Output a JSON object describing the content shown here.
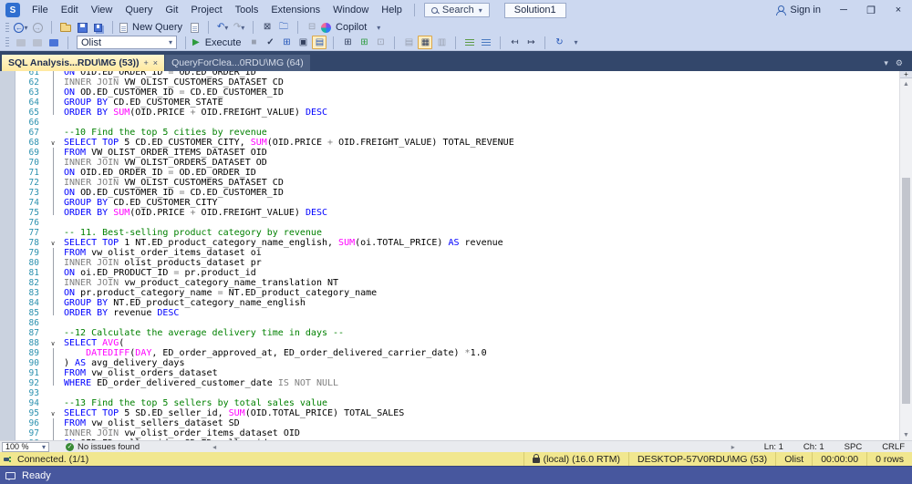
{
  "titlebar": {
    "menus": [
      "File",
      "Edit",
      "View",
      "Query",
      "Git",
      "Project",
      "Tools",
      "Extensions",
      "Window",
      "Help"
    ],
    "search_label": "Search",
    "solution_label": "Solution1",
    "sign_in_label": "Sign in"
  },
  "toolbar_standard": {
    "new_query_label": "New Query",
    "copilot_label": "Copilot"
  },
  "toolbar_sql": {
    "database_selected": "Olist",
    "execute_label": "Execute"
  },
  "tabs": [
    {
      "label": "SQL Analysis...RDU\\MG (53))",
      "active": true
    },
    {
      "label": "QueryForClea...0RDU\\MG (64)",
      "active": false
    }
  ],
  "editor": {
    "first_line_number": 61,
    "lines": [
      {
        "n": 61,
        "fold": false,
        "tokens": [
          [
            "kw",
            "ON"
          ],
          [
            "id",
            " OID.ED_ORDER_ID "
          ],
          [
            "gr",
            "="
          ],
          [
            "id",
            " OD.ED_ORDER_ID"
          ]
        ]
      },
      {
        "n": 62,
        "fold": false,
        "tokens": [
          [
            "gr",
            "INNER JOIN"
          ],
          [
            "id",
            " VW_OLIST_CUSTOMERS_DATASET CD"
          ]
        ]
      },
      {
        "n": 63,
        "fold": false,
        "tokens": [
          [
            "kw",
            "ON"
          ],
          [
            "id",
            " OD.ED_CUSTOMER_ID "
          ],
          [
            "gr",
            "="
          ],
          [
            "id",
            " CD.ED_CUSTOMER_ID"
          ]
        ]
      },
      {
        "n": 64,
        "fold": false,
        "tokens": [
          [
            "kw",
            "GROUP BY"
          ],
          [
            "id",
            " CD.ED_CUSTOMER_STATE"
          ]
        ]
      },
      {
        "n": 65,
        "fold": false,
        "tokens": [
          [
            "kw",
            "ORDER BY"
          ],
          [
            "id",
            " "
          ],
          [
            "fn",
            "SUM"
          ],
          [
            "id",
            "(OID.PRICE "
          ],
          [
            "gr",
            "+"
          ],
          [
            "id",
            " OID.FREIGHT_VALUE) "
          ],
          [
            "kw",
            "DESC"
          ]
        ]
      },
      {
        "n": 66,
        "fold": false,
        "tokens": []
      },
      {
        "n": 67,
        "fold": false,
        "tokens": [
          [
            "cm",
            "--10 Find the top 5 cities by revenue"
          ]
        ]
      },
      {
        "n": 68,
        "fold": true,
        "tokens": [
          [
            "kw",
            "SELECT TOP"
          ],
          [
            "id",
            " 5 CD.ED_CUSTOMER_CITY, "
          ],
          [
            "fn",
            "SUM"
          ],
          [
            "id",
            "(OID.PRICE "
          ],
          [
            "gr",
            "+"
          ],
          [
            "id",
            " OID.FREIGHT_VALUE) TOTAL_REVENUE"
          ]
        ]
      },
      {
        "n": 69,
        "fold": false,
        "tokens": [
          [
            "kw",
            "FROM"
          ],
          [
            "id",
            " VW_OLIST_ORDER_ITEMS_DATASET OID"
          ]
        ]
      },
      {
        "n": 70,
        "fold": false,
        "tokens": [
          [
            "gr",
            "INNER JOIN"
          ],
          [
            "id",
            " VW_OLIST_ORDERS_DATASET OD"
          ]
        ]
      },
      {
        "n": 71,
        "fold": false,
        "tokens": [
          [
            "kw",
            "ON"
          ],
          [
            "id",
            " OID.ED_ORDER_ID "
          ],
          [
            "gr",
            "="
          ],
          [
            "id",
            " OD.ED_ORDER_ID"
          ]
        ]
      },
      {
        "n": 72,
        "fold": false,
        "tokens": [
          [
            "gr",
            "INNER JOIN"
          ],
          [
            "id",
            " VW_OLIST_CUSTOMERS_DATASET CD"
          ]
        ]
      },
      {
        "n": 73,
        "fold": false,
        "tokens": [
          [
            "kw",
            "ON"
          ],
          [
            "id",
            " OD.ED_CUSTOMER_ID "
          ],
          [
            "gr",
            "="
          ],
          [
            "id",
            " CD.ED_CUSTOMER_ID"
          ]
        ]
      },
      {
        "n": 74,
        "fold": false,
        "tokens": [
          [
            "kw",
            "GROUP BY"
          ],
          [
            "id",
            " CD.ED_CUSTOMER_CITY"
          ]
        ]
      },
      {
        "n": 75,
        "fold": false,
        "tokens": [
          [
            "kw",
            "ORDER BY"
          ],
          [
            "id",
            " "
          ],
          [
            "fn",
            "SUM"
          ],
          [
            "id",
            "(OID.PRICE "
          ],
          [
            "gr",
            "+"
          ],
          [
            "id",
            " OID.FREIGHT_VALUE) "
          ],
          [
            "kw",
            "DESC"
          ]
        ]
      },
      {
        "n": 76,
        "fold": false,
        "tokens": []
      },
      {
        "n": 77,
        "fold": false,
        "tokens": [
          [
            "cm",
            "-- 11. Best-selling product category by revenue"
          ]
        ]
      },
      {
        "n": 78,
        "fold": true,
        "tokens": [
          [
            "kw",
            "SELECT TOP"
          ],
          [
            "id",
            " 1 NT.ED_product_category_name_english, "
          ],
          [
            "fn",
            "SUM"
          ],
          [
            "id",
            "(oi.TOTAL_PRICE) "
          ],
          [
            "kw",
            "AS"
          ],
          [
            "id",
            " revenue"
          ]
        ]
      },
      {
        "n": 79,
        "fold": false,
        "tokens": [
          [
            "kw",
            "FROM"
          ],
          [
            "id",
            " vw_olist_order_items_dataset oi"
          ]
        ]
      },
      {
        "n": 80,
        "fold": false,
        "tokens": [
          [
            "gr",
            "INNER JOIN"
          ],
          [
            "id",
            " olist_products_dataset pr"
          ]
        ]
      },
      {
        "n": 81,
        "fold": false,
        "tokens": [
          [
            "kw",
            "ON"
          ],
          [
            "id",
            " oi.ED_PRODUCT_ID "
          ],
          [
            "gr",
            "="
          ],
          [
            "id",
            " pr.product_id"
          ]
        ]
      },
      {
        "n": 82,
        "fold": false,
        "tokens": [
          [
            "gr",
            "INNER JOIN"
          ],
          [
            "id",
            " vw_product_category_name_translation NT"
          ]
        ]
      },
      {
        "n": 83,
        "fold": false,
        "tokens": [
          [
            "kw",
            "ON"
          ],
          [
            "id",
            " pr.product_category_name "
          ],
          [
            "gr",
            "="
          ],
          [
            "id",
            " NT.ED_product_category_name"
          ]
        ]
      },
      {
        "n": 84,
        "fold": false,
        "tokens": [
          [
            "kw",
            "GROUP BY"
          ],
          [
            "id",
            " NT.ED_product_category_name_english"
          ]
        ]
      },
      {
        "n": 85,
        "fold": false,
        "tokens": [
          [
            "kw",
            "ORDER BY"
          ],
          [
            "id",
            " revenue "
          ],
          [
            "kw",
            "DESC"
          ]
        ]
      },
      {
        "n": 86,
        "fold": false,
        "tokens": []
      },
      {
        "n": 87,
        "fold": false,
        "tokens": [
          [
            "cm",
            "--12 Calculate the average delivery time in days --"
          ]
        ]
      },
      {
        "n": 88,
        "fold": true,
        "tokens": [
          [
            "kw",
            "SELECT"
          ],
          [
            "id",
            " "
          ],
          [
            "fn",
            "AVG"
          ],
          [
            "id",
            "("
          ]
        ]
      },
      {
        "n": 89,
        "fold": false,
        "tokens": [
          [
            "id",
            "    "
          ],
          [
            "fn",
            "DATEDIFF"
          ],
          [
            "id",
            "("
          ],
          [
            "fn",
            "DAY"
          ],
          [
            "id",
            ", ED_order_approved_at, ED_order_delivered_carrier_date) "
          ],
          [
            "gr",
            "*"
          ],
          [
            "id",
            "1.0"
          ]
        ]
      },
      {
        "n": 90,
        "fold": false,
        "tokens": [
          [
            "id",
            ") "
          ],
          [
            "kw",
            "AS"
          ],
          [
            "id",
            " avg_delivery_days"
          ]
        ]
      },
      {
        "n": 91,
        "fold": false,
        "tokens": [
          [
            "kw",
            "FROM"
          ],
          [
            "id",
            " vw_olist_orders_dataset"
          ]
        ]
      },
      {
        "n": 92,
        "fold": false,
        "tokens": [
          [
            "kw",
            "WHERE"
          ],
          [
            "id",
            " ED_order_delivered_customer_date "
          ],
          [
            "gr",
            "IS NOT NULL"
          ]
        ]
      },
      {
        "n": 93,
        "fold": false,
        "tokens": []
      },
      {
        "n": 94,
        "fold": false,
        "tokens": [
          [
            "cm",
            "--13 Find the top 5 sellers by total sales value"
          ]
        ]
      },
      {
        "n": 95,
        "fold": true,
        "tokens": [
          [
            "kw",
            "SELECT TOP"
          ],
          [
            "id",
            " 5 SD.ED_seller_id, "
          ],
          [
            "fn",
            "SUM"
          ],
          [
            "id",
            "(OID.TOTAL_PRICE) TOTAL_SALES"
          ]
        ]
      },
      {
        "n": 96,
        "fold": false,
        "tokens": [
          [
            "kw",
            "FROM"
          ],
          [
            "id",
            " vw_olist_sellers_dataset SD"
          ]
        ]
      },
      {
        "n": 97,
        "fold": false,
        "tokens": [
          [
            "gr",
            "INNER JOIN"
          ],
          [
            "id",
            " vw_olist_order_items_dataset OID"
          ]
        ]
      },
      {
        "n": 98,
        "fold": false,
        "tokens": [
          [
            "kw",
            "ON"
          ],
          [
            "id",
            " OID.ED_seller_id "
          ],
          [
            "gr",
            "="
          ],
          [
            "id",
            " SD.ED_seller_id"
          ]
        ]
      }
    ],
    "fold_segments": [
      {
        "from": 0,
        "to": 4
      },
      {
        "from": 8,
        "to": 14
      },
      {
        "from": 18,
        "to": 24
      },
      {
        "from": 28,
        "to": 31
      },
      {
        "from": 35,
        "to": 37
      }
    ]
  },
  "editor_status": {
    "zoom": "100 %",
    "health": "No issues found",
    "caret": [
      "Ln: 1",
      "Ch: 1",
      "SPC",
      "CRLF"
    ]
  },
  "connection_bar": {
    "status": "Connected. (1/1)",
    "segments": [
      "(local) (16.0 RTM)",
      "DESKTOP-57V0RDU\\MG (53)",
      "Olist",
      "00:00:00",
      "0 rows"
    ]
  },
  "app_status": {
    "message": "Ready"
  },
  "colors": {
    "keyword": "#0000ff",
    "system_function": "#ff00ff",
    "comment": "#008000",
    "operator_gray": "#808080",
    "line_number": "#2b91af",
    "active_tab": "#ffe9a0",
    "tab_well": "#33476b",
    "connection_bar": "#f1e78f",
    "status_bar": "#47579e",
    "execute_green": "#2e9b3e"
  }
}
